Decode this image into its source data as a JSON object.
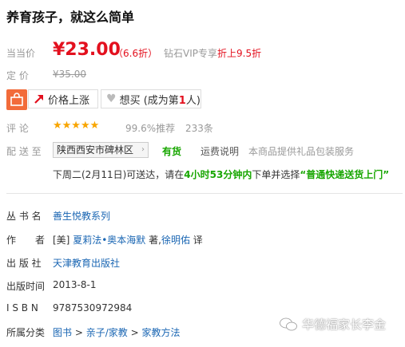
{
  "title": "养育孩子，就这么简单",
  "price": {
    "label": "当当价",
    "value": "¥23.00",
    "discount": "（6.6折）",
    "vip_prefix": "钻石VIP专享",
    "vip_highlight": "折上9.5折",
    "orig_label": "定 价",
    "orig_value": "¥35.00"
  },
  "buttons": {
    "price_drop": "价格上涨",
    "want_prefix": "想买 (成为第",
    "want_num": "1",
    "want_suffix": "人)"
  },
  "review": {
    "label": "评 论",
    "stars": "★★★★★",
    "rating": 5,
    "recommend": "99.6%推荐",
    "count": "233条"
  },
  "delivery": {
    "label": "配 送 至",
    "region": "陕西西安市碑林区",
    "stock": "有货",
    "shipping_link": "运费说明",
    "gift_note": "本商品提供礼品包装服务",
    "line_a": "下周二(2月11日)可送达，请在",
    "line_b": "4小时53分钟内",
    "line_c": "下单并选择",
    "line_d": "“普通快递送货上门”"
  },
  "info": {
    "series_label": "丛 书 名",
    "series_value": "善生悦教系列",
    "author_label": "作　　者",
    "author_prefix": "[美]",
    "author_1": "夏莉法•奥本海默",
    "author_mid": "著,",
    "author_2": "徐明佑",
    "author_suffix": "译",
    "publisher_label": "出 版 社",
    "publisher_value": "天津教育出版社",
    "pubdate_label": "出版时间",
    "pubdate_value": "2013-8-1",
    "isbn_label": "I S B N",
    "isbn_value": "9787530972984",
    "category_label": "所属分类",
    "category_1": "图书",
    "category_sep1": ">",
    "category_2": "亲子/家教",
    "category_sep2": ">",
    "category_3": "家教方法"
  },
  "watermark": "华德福家长李金",
  "colors": {
    "price_red": "#e3101e",
    "link_blue": "#1a66b3",
    "stock_green": "#17a600",
    "star_orange": "#f8a500",
    "icon_orange": "#f26b3a"
  }
}
